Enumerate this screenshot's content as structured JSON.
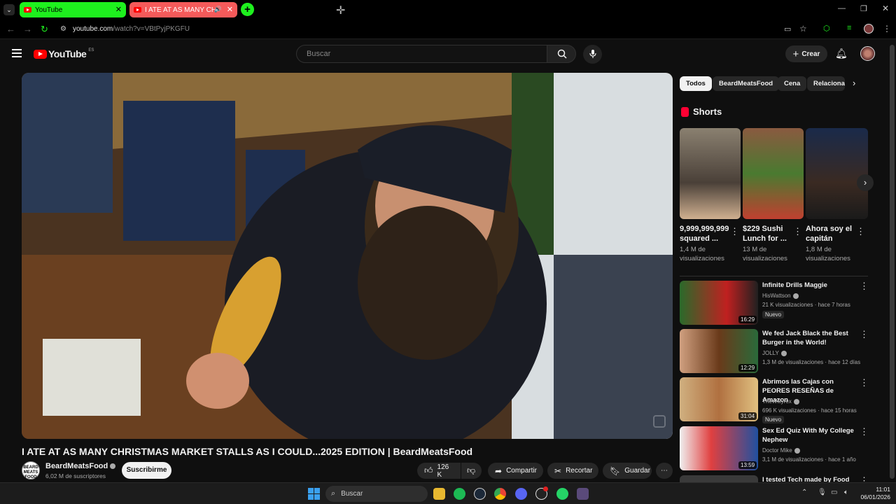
{
  "browser": {
    "tabs": [
      {
        "title": "YouTube",
        "active": true
      },
      {
        "title": "I ATE AT AS MANY CHRISTM",
        "active": false
      }
    ],
    "url_host": "youtube.com",
    "url_path": "/watch?v=VBtPyjPKGFU"
  },
  "header": {
    "logo": "YouTube",
    "region": "ES",
    "search_placeholder": "Buscar",
    "create_label": "Crear"
  },
  "video": {
    "title": "I ATE AT AS MANY CHRISTMAS MARKET STALLS AS I COULD...2025 EDITION | BeardMeatsFood",
    "channel": "BeardMeatsFood",
    "subscribers": "6,02 M de suscriptores",
    "subscribe_label": "Suscribirme",
    "likes": "126 K",
    "share_label": "Compartir",
    "clip_label": "Recortar",
    "save_label": "Guardar"
  },
  "chips": [
    "Todos",
    "BeardMeatsFood",
    "Cena",
    "Relaciona"
  ],
  "shorts": {
    "heading": "Shorts",
    "items": [
      {
        "title": "9,999,999,999 squared ...",
        "views": "1,4 M de visualizaciones"
      },
      {
        "title": "$229 Sushi Lunch for ...",
        "views": "13 M de visualizaciones"
      },
      {
        "title": "Ahora soy el capitán",
        "views": "1,8 M de visualizaciones"
      }
    ]
  },
  "recommendations": [
    {
      "title": "Infinite Drills Maggie",
      "channel": "HisWattson",
      "meta": "21 K visualizaciones · hace 7 horas",
      "badge": "Nuevo",
      "duration": "16:29"
    },
    {
      "title": "We fed Jack Black the Best Burger in the World!",
      "channel": "JOLLY",
      "meta": "1,3 M de visualizaciones · hace 12 días",
      "badge": "",
      "duration": "12:29"
    },
    {
      "title": "Abrimos las Cajas con PEORES RESEÑAS de Amazon",
      "channel": "TheWillyrex",
      "meta": "696 K visualizaciones · hace 15 horas",
      "badge": "Nuevo",
      "duration": "31:04"
    },
    {
      "title": "Sex Ed Quiz With My College Nephew",
      "channel": "Doctor Mike",
      "meta": "3,1 M de visualizaciones · hace 1 año",
      "badge": "",
      "duration": "13:59"
    },
    {
      "title": "I tested Tech made by Food",
      "channel": "",
      "meta": "",
      "badge": "",
      "duration": ""
    }
  ],
  "taskbar": {
    "search_placeholder": "Buscar",
    "time": "11:01",
    "date": "06/01/2026"
  },
  "colors": {
    "tab_active": "#1ef01e",
    "tab_inactive": "#f55a5a",
    "yt_red": "#ff0000",
    "bg": "#0f0f0f"
  }
}
